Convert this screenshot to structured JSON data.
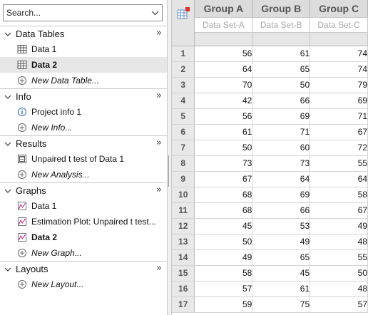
{
  "navigator": {
    "search_placeholder": "Search...",
    "sections": [
      {
        "title": "Data Tables",
        "more": "»",
        "items": [
          {
            "label": "Data 1",
            "icon": "table-icon",
            "selected": false,
            "bold": false,
            "new": false
          },
          {
            "label": "Data 2",
            "icon": "table-icon",
            "selected": true,
            "bold": true,
            "new": false
          },
          {
            "label": "New Data Table...",
            "icon": "add-circle-icon",
            "selected": false,
            "bold": false,
            "new": true
          }
        ]
      },
      {
        "title": "Info",
        "more": "»",
        "items": [
          {
            "label": "Project info 1",
            "icon": "info-icon",
            "selected": false,
            "bold": false,
            "new": false
          },
          {
            "label": "New Info...",
            "icon": "add-circle-icon",
            "selected": false,
            "bold": false,
            "new": true
          }
        ]
      },
      {
        "title": "Results",
        "more": "»",
        "items": [
          {
            "label": "Unpaired t test of Data 1",
            "icon": "results-icon",
            "selected": false,
            "bold": false,
            "new": false
          },
          {
            "label": "New Analysis...",
            "icon": "add-circle-icon",
            "selected": false,
            "bold": false,
            "new": true
          }
        ]
      },
      {
        "title": "Graphs",
        "more": "»",
        "items": [
          {
            "label": "Data 1",
            "icon": "graph-icon",
            "selected": false,
            "bold": false,
            "new": false
          },
          {
            "label": "Estimation Plot: Unpaired t test...",
            "icon": "graph-icon",
            "selected": false,
            "bold": false,
            "new": false
          },
          {
            "label": "Data 2",
            "icon": "graph-icon",
            "selected": false,
            "bold": true,
            "new": false
          },
          {
            "label": "New Graph...",
            "icon": "add-circle-icon",
            "selected": false,
            "bold": false,
            "new": true
          }
        ]
      },
      {
        "title": "Layouts",
        "more": "»",
        "items": [
          {
            "label": "New Layout...",
            "icon": "add-circle-icon",
            "selected": false,
            "bold": false,
            "new": true
          }
        ]
      }
    ]
  },
  "sheet": {
    "columns": [
      {
        "header": "Group A",
        "subheader": "Data Set-A"
      },
      {
        "header": "Group B",
        "subheader": "Data Set-B"
      },
      {
        "header": "Group C",
        "subheader": "Data Set-C"
      }
    ],
    "rows": [
      {
        "num": "1",
        "values": [
          "56",
          "61",
          "74"
        ]
      },
      {
        "num": "2",
        "values": [
          "64",
          "65",
          "74"
        ]
      },
      {
        "num": "3",
        "values": [
          "70",
          "50",
          "79"
        ]
      },
      {
        "num": "4",
        "values": [
          "42",
          "66",
          "69"
        ]
      },
      {
        "num": "5",
        "values": [
          "56",
          "69",
          "71"
        ]
      },
      {
        "num": "6",
        "values": [
          "61",
          "71",
          "67"
        ]
      },
      {
        "num": "7",
        "values": [
          "50",
          "60",
          "72"
        ]
      },
      {
        "num": "8",
        "values": [
          "73",
          "73",
          "55"
        ]
      },
      {
        "num": "9",
        "values": [
          "67",
          "64",
          "64"
        ]
      },
      {
        "num": "10",
        "values": [
          "68",
          "69",
          "58"
        ]
      },
      {
        "num": "11",
        "values": [
          "68",
          "66",
          "67"
        ]
      },
      {
        "num": "12",
        "values": [
          "45",
          "53",
          "49"
        ]
      },
      {
        "num": "13",
        "values": [
          "50",
          "49",
          "48"
        ]
      },
      {
        "num": "14",
        "values": [
          "49",
          "65",
          "55"
        ]
      },
      {
        "num": "15",
        "values": [
          "58",
          "45",
          "50"
        ]
      },
      {
        "num": "16",
        "values": [
          "57",
          "61",
          "48"
        ]
      },
      {
        "num": "17",
        "values": [
          "59",
          "75",
          "57"
        ]
      }
    ]
  }
}
